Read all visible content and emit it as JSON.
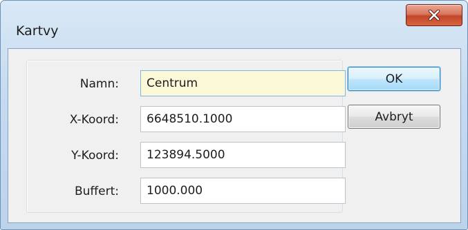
{
  "window": {
    "title": "Kartvy"
  },
  "form": {
    "fields": [
      {
        "label": "Namn:",
        "value": "Centrum"
      },
      {
        "label": "X-Koord:",
        "value": "6648510.1000"
      },
      {
        "label": "Y-Koord:",
        "value": "123894.5000"
      },
      {
        "label": "Buffert:",
        "value": "1000.000"
      }
    ]
  },
  "buttons": {
    "ok_label": "OK",
    "cancel_label": "Avbryt"
  },
  "icons": {
    "close": "close-icon"
  },
  "colors": {
    "focused_field_bg": "#fbf8d8",
    "close_button": "#c2452a",
    "default_button": "#bee6fd"
  }
}
